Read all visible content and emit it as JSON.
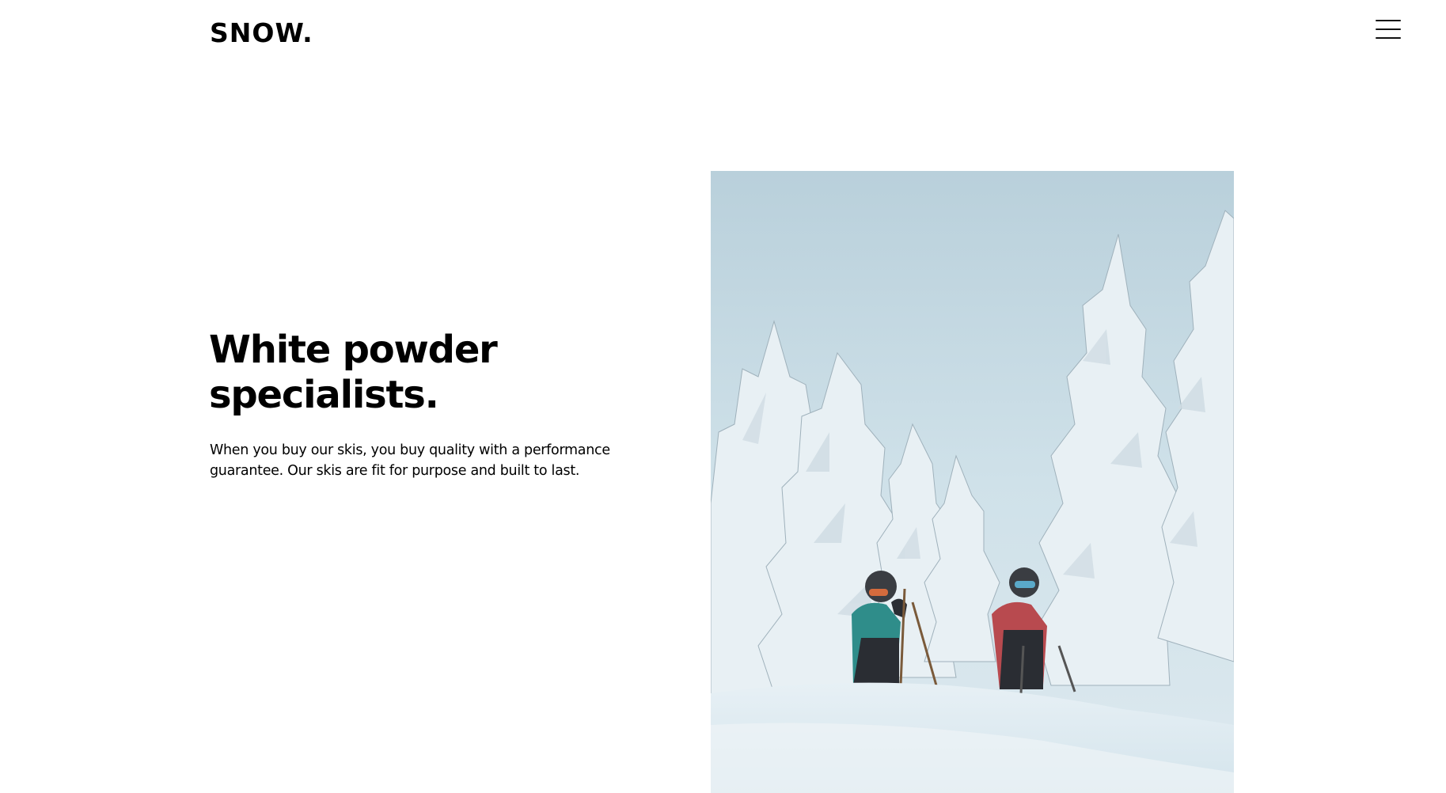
{
  "header": {
    "logo": "SNOW.",
    "menu_icon": "hamburger-menu-icon"
  },
  "hero": {
    "heading": "White powder specialists.",
    "body": "When you buy our skis, you buy quality with a performance guarantee. Our skis are fit for purpose and built to last."
  },
  "image": {
    "description_icon": "photo-snowy-forest-skiers",
    "sky_color": "#c9dde6",
    "snow_color": "#eef4f7"
  }
}
